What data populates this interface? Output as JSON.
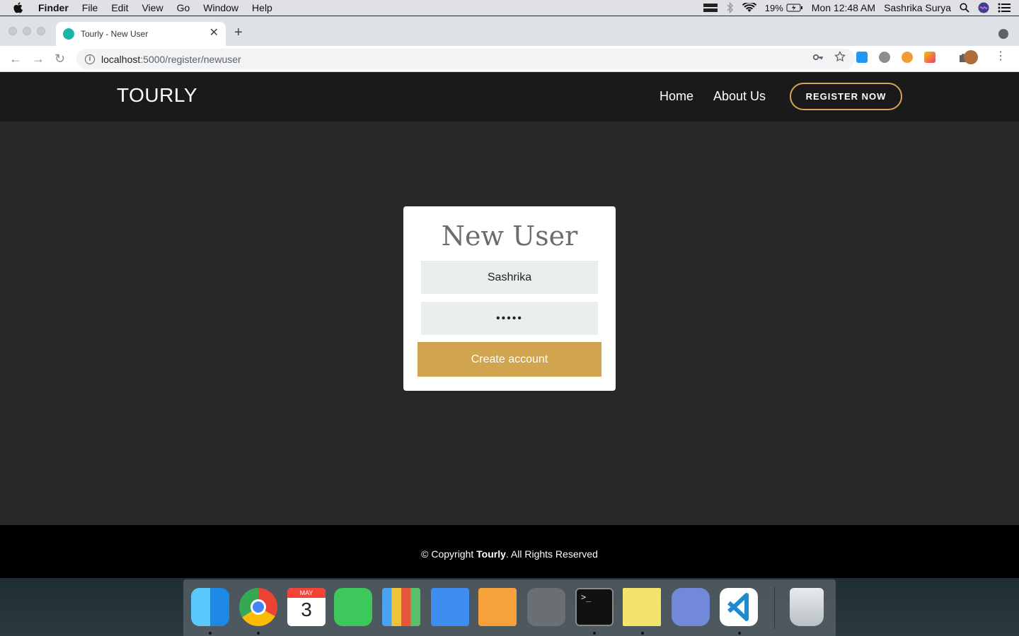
{
  "menubar": {
    "app": "Finder",
    "items": [
      "File",
      "Edit",
      "View",
      "Go",
      "Window",
      "Help"
    ],
    "battery": "19%",
    "clock": "Mon 12:48 AM",
    "user": "Sashrika Surya"
  },
  "browser": {
    "tab_title": "Tourly - New User",
    "url_host": "localhost",
    "url_path": ":5000/register/newuser"
  },
  "site": {
    "logo": "TOURLY",
    "nav": [
      "Home",
      "About Us"
    ],
    "register_label": "REGISTER NOW",
    "form": {
      "title": "New User",
      "username_value": "Sashrika",
      "password_value": "•••••",
      "submit_label": "Create account"
    },
    "footer": {
      "prefix": "© Copyright ",
      "brand": "Tourly",
      "suffix": ". All Rights Reserved"
    }
  },
  "dock": {
    "apps": [
      "finder-icon",
      "chrome-icon",
      "calendar-icon",
      "facetime-icon",
      "numbers-icon",
      "keynote-icon",
      "pages-icon",
      "system-preferences-icon",
      "terminal-icon",
      "stickies-icon",
      "discord-icon",
      "vscode-icon",
      "trash-icon"
    ],
    "calendar_month": "MAY",
    "calendar_day": "3"
  },
  "colors": {
    "accent": "#d1a550",
    "header_bg": "#1a1a1a",
    "main_bg": "#282828"
  }
}
